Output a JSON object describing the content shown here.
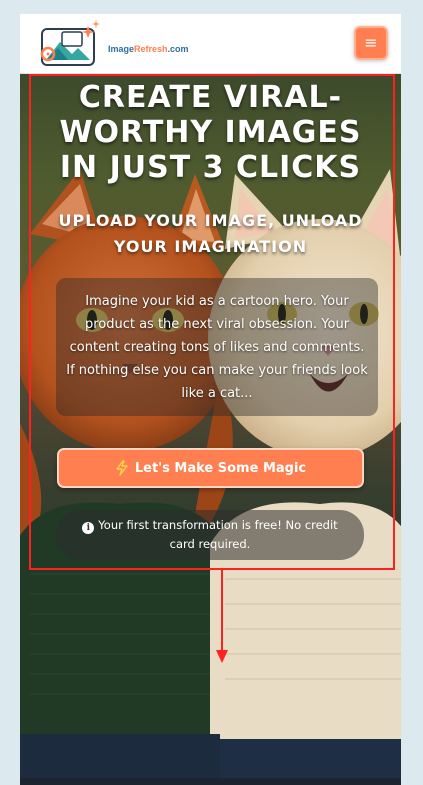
{
  "navbar": {
    "logo": {
      "brand_part1": "Image",
      "brand_part2": "Refresh",
      "brand_part3": ".com"
    },
    "menu_icon": "hamburger-icon",
    "menu_glyph": "≡"
  },
  "hero": {
    "title_lines": [
      "CREATE VIRAL-",
      "WORTHY IMAGES",
      "IN JUST 3 CLICKS"
    ],
    "subtitle_lines": [
      "UPLOAD YOUR IMAGE, UNLOAD",
      "YOUR IMAGINATION"
    ],
    "description": "Imagine your kid as a cartoon hero. Your product as the next viral obsession. Your content creating tons of likes and comments. If nothing else you can make your friends look like a cat...",
    "cta_label": "Let's Make Some Magic",
    "cta_icon": "lightning-icon",
    "free_note_icon": "info-icon",
    "free_note_glyph": "i",
    "free_note": "Your first transformation is free! No credit card required."
  },
  "colors": {
    "accent": "#ff7f50",
    "highlight": "#ff2020",
    "page_bg": "#dce9ee"
  }
}
